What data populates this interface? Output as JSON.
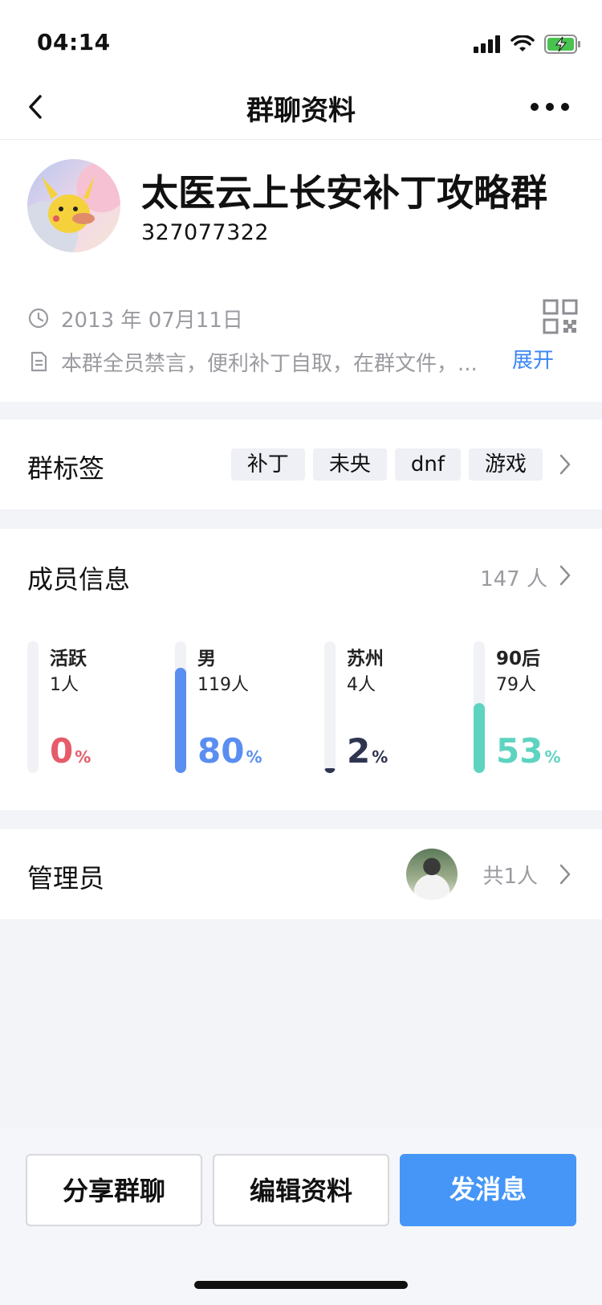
{
  "status_bar": {
    "time": "04:14"
  },
  "nav": {
    "title": "群聊资料"
  },
  "group": {
    "name": "太医云上长安补丁攻略群",
    "id": "327077322"
  },
  "meta": {
    "date": "2013 年 07月11日",
    "description": "本群全员禁言，便利补丁自取，在群文件，...",
    "expand_label": "展开"
  },
  "tags_section": {
    "label": "群标签",
    "tags": [
      "补丁",
      "未央",
      "dnf",
      "游戏"
    ]
  },
  "members_section": {
    "label": "成员信息",
    "count": "147 人",
    "stats": [
      {
        "label": "活跃",
        "sub": "1人",
        "percent": "0",
        "value": 0,
        "color": "#e65c6a"
      },
      {
        "label": "男",
        "sub": "119人",
        "percent": "80",
        "value": 80,
        "color": "#5a8ef0"
      },
      {
        "label": "苏州",
        "sub": "4人",
        "percent": "2",
        "value": 2,
        "color": "#2f3550"
      },
      {
        "label": "90后",
        "sub": "79人",
        "percent": "53",
        "value": 53,
        "color": "#5ed4c0"
      }
    ],
    "percent_sign": "%"
  },
  "admin_section": {
    "label": "管理员",
    "count": "共1人"
  },
  "actions": {
    "share": "分享群聊",
    "edit": "编辑资料",
    "message": "发消息"
  },
  "icons": {
    "back": "chevron-left-icon",
    "more": "more-dots-icon",
    "clock": "clock-icon",
    "doc": "document-icon",
    "qr": "qr-code-icon",
    "chevron": "chevron-right-icon"
  }
}
